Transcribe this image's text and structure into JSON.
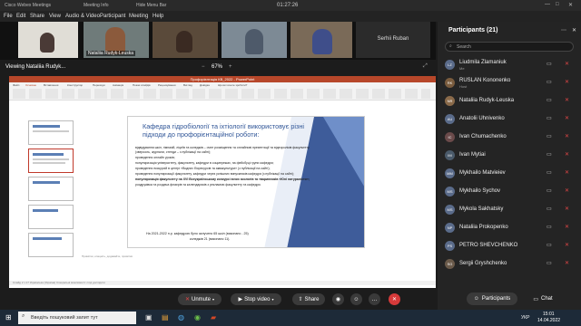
{
  "window": {
    "app_title": "Cisco Webex Meetings",
    "meeting_info": "Meeting Info",
    "hide_menu_bar": "Hide Menu Bar",
    "time": "01:27:26"
  },
  "menu": [
    "File",
    "Edit",
    "Share",
    "View",
    "Audio & Video",
    "Participant",
    "Meeting",
    "Help"
  ],
  "video_tiles": [
    {
      "name": ""
    },
    {
      "name": "Nataliia Rudyk-Leuska"
    },
    {
      "name": ""
    },
    {
      "name": ""
    },
    {
      "name": ""
    },
    {
      "name": "Serhii Ruban"
    }
  ],
  "share": {
    "label": "Viewing Nataliia Rudyk...",
    "zoom": "67%"
  },
  "ppt": {
    "window_title": "Профорієнтація КВ_2022 - PowerPoint",
    "tabs": [
      "Файл",
      "Основне",
      "Вставлення",
      "Конструктор",
      "Переходи",
      "Анімація",
      "Показ слайдів",
      "Рецензування",
      "Вигляд",
      "Довідка",
      "Що ви хочете зробити?"
    ],
    "notes_placeholder": "Примітки, клацніть, додавайте, примітки",
    "status": "Слайд 2 з 17   Українська (Україна)   Спеціальні можливості: слід дослідити"
  },
  "slide": {
    "title": "Кафедра гідробіології та іхтіології використовує різні підходи до профорієнтаційної роботи:",
    "bullets": [
      "відвідування шкіл, гімназій, ліцеїв та коледжів – очне розміщення та онлайнові презентації та відеороліків факультету (зверсоль, журнали, стенди – з публікації на сайті);",
      "проведення онлайн уроків;",
      "популяризація університету, факультету, кафедри в соцмережах, на фейсбуці групи кафедри;",
      "проведення екскурсій в центрі «Водних біоресурсів та аквакультури» (з публікації на сайті);",
      "проведення популяризації факультету, кафедри через успішних випускників кафедри (з публікації на сайті);",
      "популяризація факультету на XVI Всеукраїнському конкурсі юних зоологів та тваринників «Юні натуралісти»;",
      "роздруківка та роздача флаєрів та календариків з рекламою факультету та кафедри."
    ],
    "footer1": "На 2021-2022 н.р. кафедрою було залучено 65 шкіл (виконано - 25)",
    "footer2": "коледжів 21   (виконано 11)."
  },
  "controls": {
    "unmute": "Unmute",
    "stop_video": "Stop video",
    "share": "Share"
  },
  "panel": {
    "title": "Participants (21)",
    "search_placeholder": "Search",
    "participants": [
      {
        "initials": "LZ",
        "name": "Liudmila Zlamaniuk",
        "role": "Me",
        "color": "#5a6b8a"
      },
      {
        "initials": "RK",
        "name": "RUSLAN Kononenko",
        "role": "Host",
        "color": "#7a5c3e"
      },
      {
        "initials": "NR",
        "name": "Nataliia Rudyk-Leuska",
        "role": "",
        "color": "#8a6a4a"
      },
      {
        "initials": "AU",
        "name": "Anatolii Uhnivenko",
        "role": "",
        "color": "#5a6b8a"
      },
      {
        "initials": "IC",
        "name": "Ivan Chumachenko",
        "role": "",
        "color": "#6a4a4a"
      },
      {
        "initials": "IM",
        "name": "Ivan Mytiai",
        "role": "",
        "color": "#4a5a6a"
      },
      {
        "initials": "MM",
        "name": "Mykhailo Matvieiev",
        "role": "",
        "color": "#5a6b8a"
      },
      {
        "initials": "MS",
        "name": "Mykhailo Sychov",
        "role": "",
        "color": "#5a6b8a"
      },
      {
        "initials": "MS",
        "name": "Mykola Sakhatsky",
        "role": "",
        "color": "#5a6b8a"
      },
      {
        "initials": "NP",
        "name": "Nataliia Prokopenko",
        "role": "",
        "color": "#5a6b8a"
      },
      {
        "initials": "PS",
        "name": "PETRO SHEVCHENKO",
        "role": "",
        "color": "#5a6b8a"
      },
      {
        "initials": "SG",
        "name": "Sergii Gryshchenko",
        "role": "",
        "color": "#6a5a4a"
      }
    ],
    "participants_tab": "Participants",
    "chat_tab": "Chat"
  },
  "taskbar": {
    "search_text": "Введіть пошуковий запит тут",
    "lang": "УКР",
    "clock_time": "15:01",
    "clock_date": "14.04.2022"
  }
}
